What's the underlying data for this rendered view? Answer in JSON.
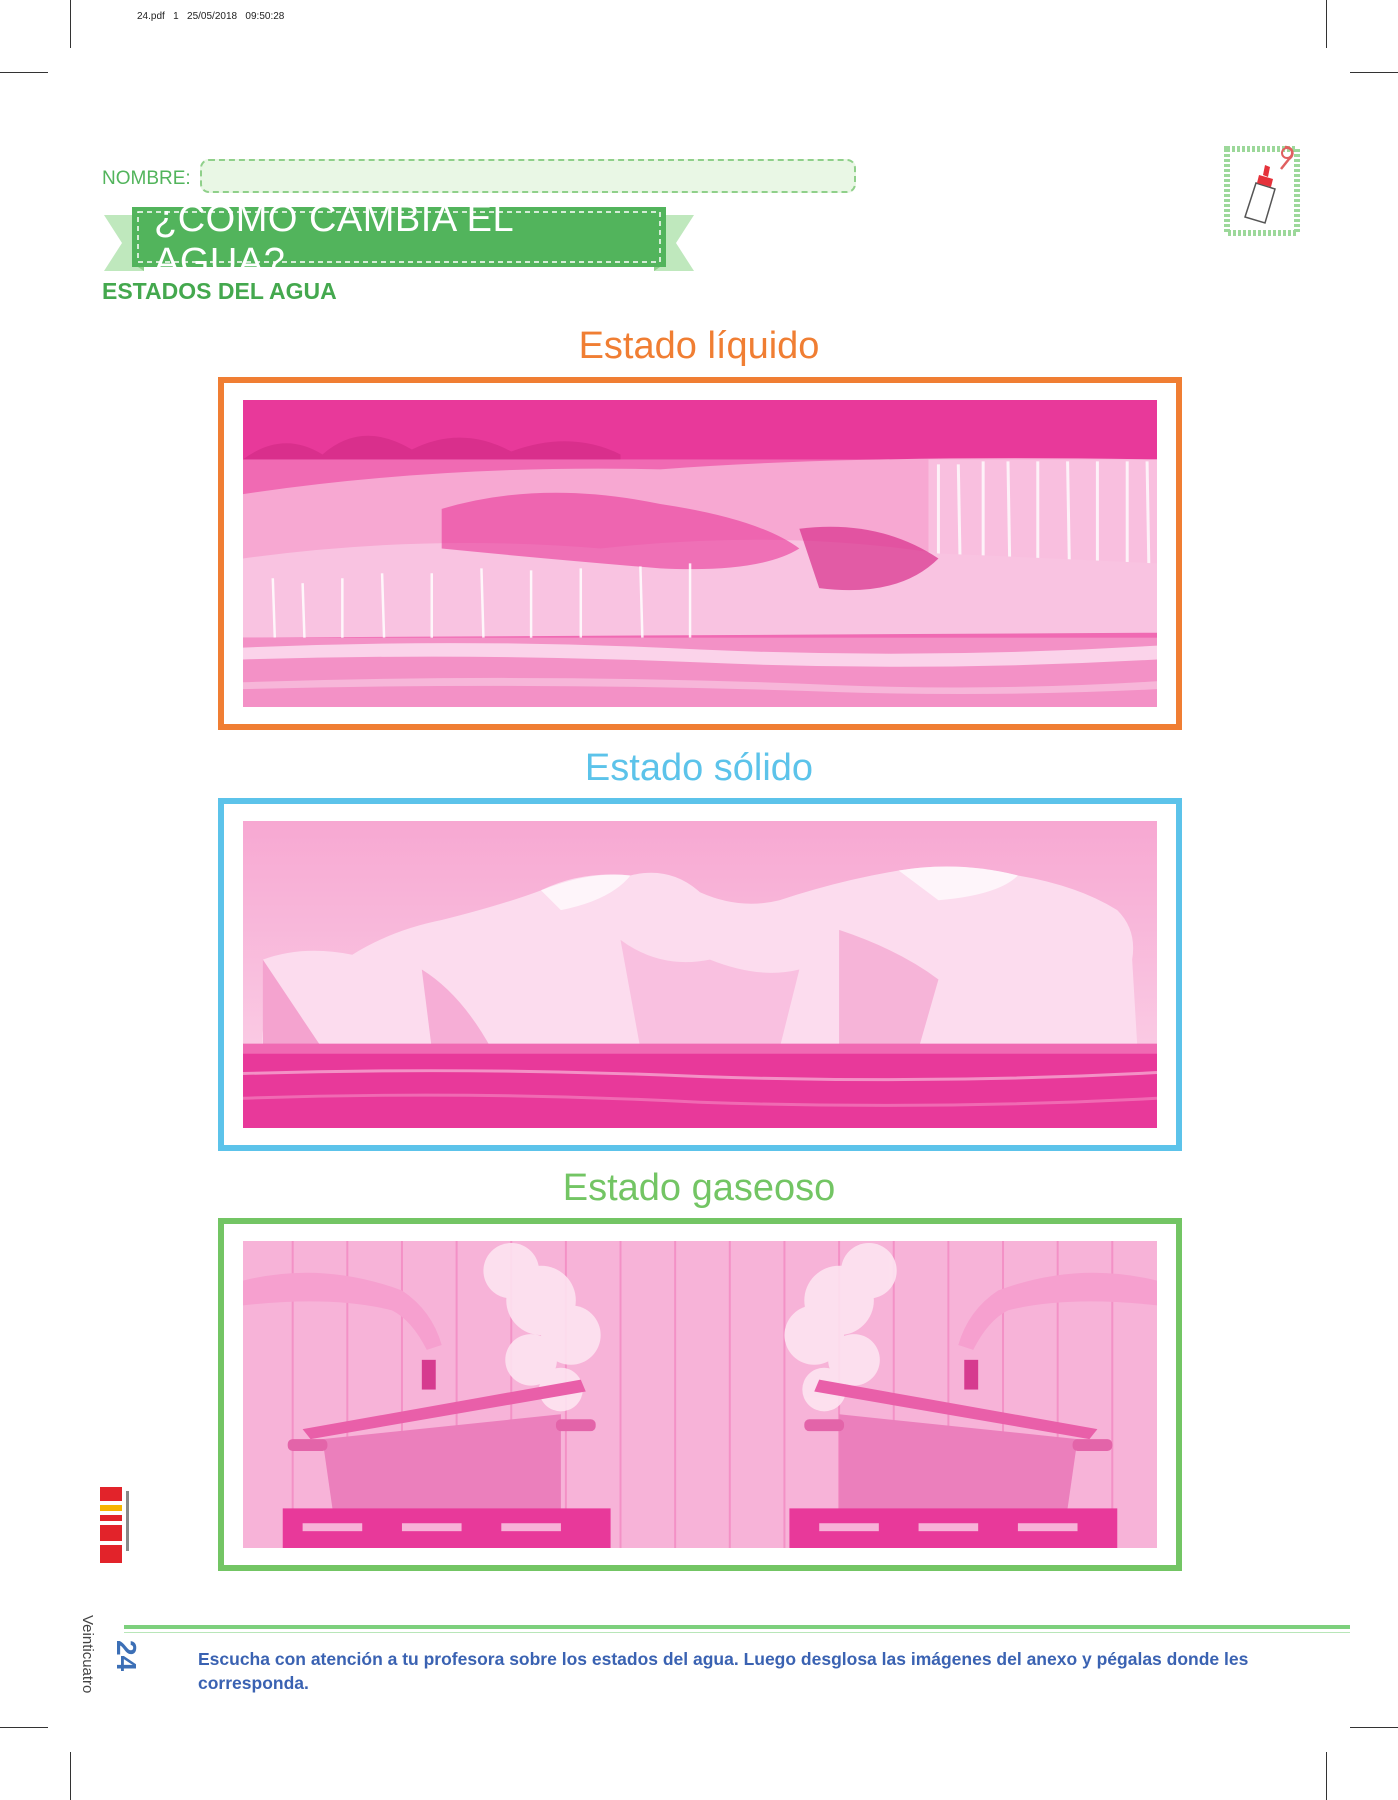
{
  "print_info": "24.pdf   1   25/05/2018   09:50:28",
  "header": {
    "name_label": "NOMBRE:",
    "name_value": "",
    "title": "¿CÓMO CAMBIA EL AGUA?",
    "subtitle": "ESTADOS DEL AGUA"
  },
  "sections": [
    {
      "title": "Estado líquido",
      "color": "#f07e33",
      "image_icon": "waterfall-image"
    },
    {
      "title": "Estado sólido",
      "color": "#5cc3ea",
      "image_icon": "iceberg-image"
    },
    {
      "title": "Estado gaseoso",
      "color": "#73c564",
      "image_icon": "steaming-pots-image"
    }
  ],
  "brand": {
    "logo_icon": "brand-logo",
    "colors": [
      "#e2232a",
      "#f7b500"
    ]
  },
  "footer": {
    "page_word": "Veinticuatro",
    "page_number": "24",
    "instructions": "Escucha con atención a tu profesora sobre los estados del agua. Luego desglosa las imágenes del anexo y pégalas donde les corresponda."
  },
  "colors": {
    "accent_green": "#52b45c",
    "photo_tint": "#e8399a",
    "instruction_blue": "#3a62b2"
  }
}
